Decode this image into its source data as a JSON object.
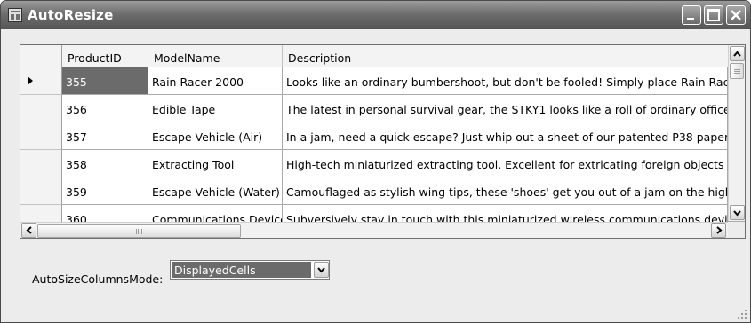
{
  "window": {
    "title": "AutoResize",
    "icon": "app-window-icon",
    "controls": [
      "minimize",
      "maximize",
      "close"
    ]
  },
  "grid": {
    "columns": [
      "ProductID",
      "ModelName",
      "Description"
    ],
    "current_row_index": 0,
    "rows": [
      {
        "id": "355",
        "model": "Rain Racer 2000",
        "description": "Looks like an ordinary bumbershoot, but don't be fooled! Simply place Rain Racer"
      },
      {
        "id": "356",
        "model": "Edible Tape",
        "description": "The latest in personal survival gear, the STKY1 looks like a roll of ordinary office"
      },
      {
        "id": "357",
        "model": "Escape Vehicle (Air)",
        "description": "In a jam, need a quick escape? Just whip out a sheet of our patented P38 paper"
      },
      {
        "id": "358",
        "model": "Extracting Tool",
        "description": "High-tech miniaturized extracting tool. Excellent for extricating foreign objects fr"
      },
      {
        "id": "359",
        "model": "Escape Vehicle (Water)",
        "description": "Camouflaged as stylish wing tips, these 'shoes' get you out of a jam on the high"
      },
      {
        "id": "360",
        "model": "Communications Device",
        "description": "Subversively stay in touch with this miniaturized wireless communications device."
      }
    ]
  },
  "options": {
    "label": "AutoSizeColumnsMode:",
    "selected": "DisplayedCells"
  },
  "colors": {
    "selection": "#6b6b6b",
    "titlebar": "#6e6e6e",
    "header": "#f3f3f3",
    "background": "#ececec"
  }
}
